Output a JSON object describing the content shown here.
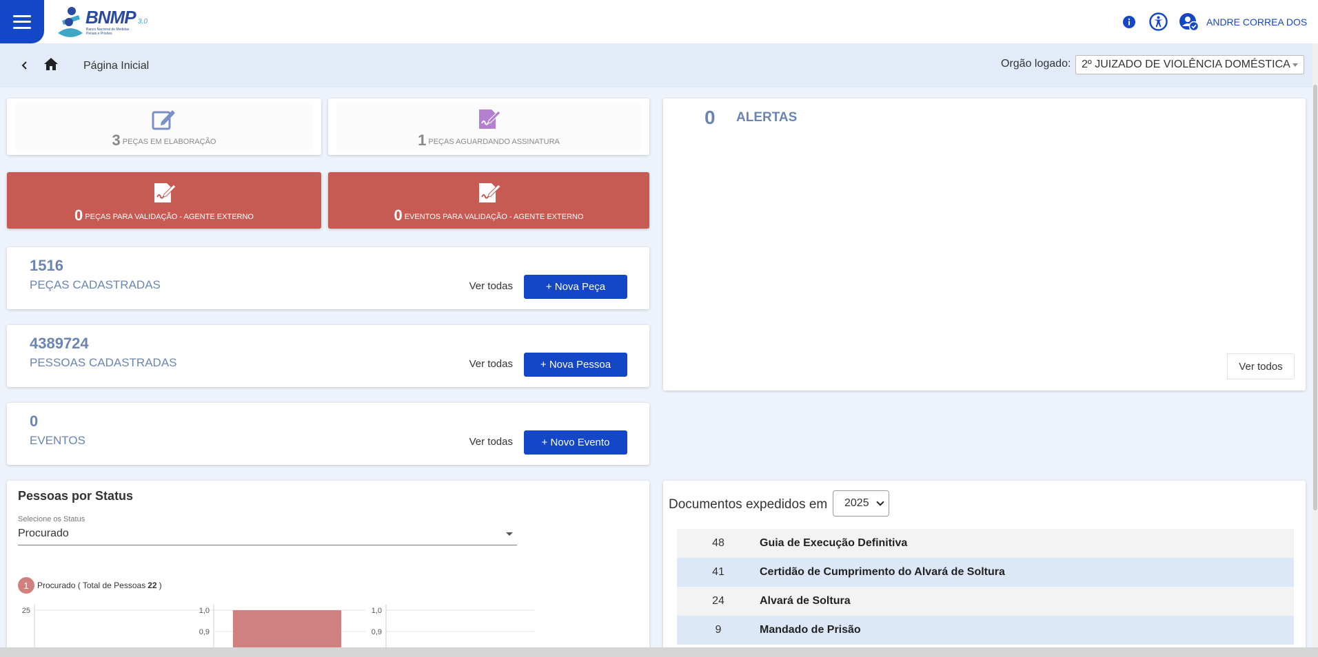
{
  "header": {
    "logo_text": "BNMP",
    "logo_version": "3.0",
    "logo_subtitle": "Banco Nacional de Medidas Penais e Prisões",
    "user_name": "ANDRE CORREA DOS S...",
    "icons": [
      "menu-icon",
      "info-icon",
      "accessibility-icon",
      "user-check-icon"
    ]
  },
  "breadcrumb": {
    "label": "Página Inicial",
    "org_label": "Orgão logado:",
    "org_value": "2º JUIZADO DE VIOLÊNCIA DOMÉSTICA"
  },
  "stats": [
    {
      "num": "3",
      "label": "PEÇAS EM ELABORAÇÃO"
    },
    {
      "num": "1",
      "label": "PEÇAS AGUARDANDO ASSINATURA"
    },
    {
      "num": "0",
      "label": "PEÇAS PARA VALIDAÇÃO - AGENTE EXTERNO"
    },
    {
      "num": "0",
      "label": "EVENTOS PARA VALIDAÇÃO - AGENTE EXTERNO"
    }
  ],
  "counts": [
    {
      "num": "1516",
      "label": "PEÇAS CADASTRADAS",
      "link": "Ver todas",
      "button": "+ Nova Peça"
    },
    {
      "num": "4389724",
      "label": "PESSOAS CADASTRADAS",
      "link": "Ver todas",
      "button": "+ Nova Pessoa"
    },
    {
      "num": "0",
      "label": "EVENTOS",
      "link": "Ver todas",
      "button": "+ Novo Evento"
    }
  ],
  "alerts": {
    "num": "0",
    "label": "ALERTAS",
    "button": "Ver todos"
  },
  "status_panel": {
    "title": "Pessoas por Status",
    "select_label": "Selecione os Status",
    "select_value": "Procurado",
    "legend_num": "1",
    "legend_text": "Procurado ( Total de Pessoas",
    "legend_total": "22",
    "legend_close": ")"
  },
  "chart_data": {
    "type": "bar",
    "series": [
      {
        "name": "Procurado",
        "values": [
          1.0
        ]
      }
    ],
    "axes": [
      {
        "ticks": [
          "25"
        ]
      },
      {
        "ticks": [
          "1,0",
          "0,9"
        ]
      },
      {
        "ticks": [
          "1,0",
          "0,9"
        ]
      }
    ],
    "colors": {
      "bar": "#d18080"
    }
  },
  "documents": {
    "title": "Documentos expedidos em",
    "year": "2025",
    "rows": [
      {
        "count": "48",
        "name": "Guia de Execução Definitiva"
      },
      {
        "count": "41",
        "name": "Certidão de Cumprimento do Alvará de Soltura"
      },
      {
        "count": "24",
        "name": "Alvará de Soltura"
      },
      {
        "count": "9",
        "name": "Mandado de Prisão"
      }
    ]
  }
}
